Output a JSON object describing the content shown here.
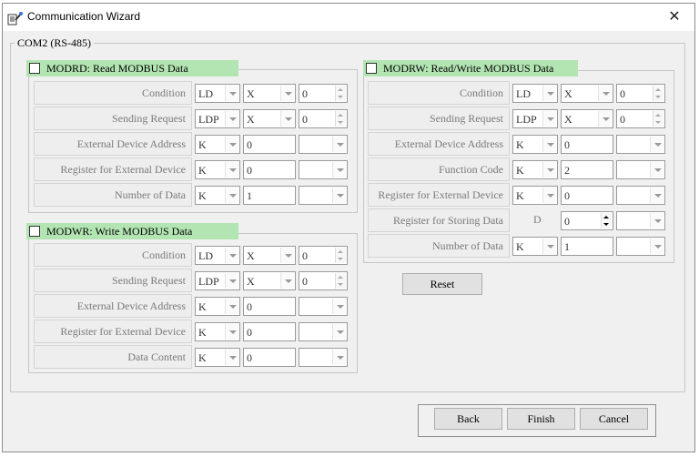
{
  "window": {
    "title": "Communication Wizard",
    "close_glyph": "✕",
    "icon": "wizard-app-icon"
  },
  "group": {
    "label": "COM2 (RS-485)"
  },
  "modrd": {
    "title": "MODRD: Read MODBUS Data",
    "checked": false,
    "rows": [
      {
        "label": "Condition",
        "type": "LD",
        "dev": "X",
        "num": "0"
      },
      {
        "label": "Sending Request",
        "type": "LDP",
        "dev": "X",
        "num": "0"
      },
      {
        "label": "External Device Address",
        "type": "K",
        "value": "0",
        "extra": ""
      },
      {
        "label": "Register for External Device",
        "type": "K",
        "value": "0",
        "extra": ""
      },
      {
        "label": "Number of Data",
        "type": "K",
        "value": "1",
        "extra": ""
      }
    ]
  },
  "modwr": {
    "title": "MODWR: Write MODBUS Data",
    "checked": false,
    "rows": [
      {
        "label": "Condition",
        "type": "LD",
        "dev": "X",
        "num": "0"
      },
      {
        "label": "Sending Request",
        "type": "LDP",
        "dev": "X",
        "num": "0"
      },
      {
        "label": "External Device Address",
        "type": "K",
        "value": "0",
        "extra": ""
      },
      {
        "label": "Register for External Device",
        "type": "K",
        "value": "0",
        "extra": ""
      },
      {
        "label": "Data Content",
        "type": "K",
        "value": "0",
        "extra": ""
      }
    ]
  },
  "modrw": {
    "title": "MODRW: Read/Write MODBUS Data",
    "checked": false,
    "rows": [
      {
        "label": "Condition",
        "type": "LD",
        "dev": "X",
        "num": "0"
      },
      {
        "label": "Sending Request",
        "type": "LDP",
        "dev": "X",
        "num": "0"
      },
      {
        "label": "External Device Address",
        "type": "K",
        "value": "0",
        "extra": ""
      },
      {
        "label": "Function Code",
        "type": "K",
        "value": "2",
        "extra": ""
      },
      {
        "label": "Register for External Device",
        "type": "K",
        "value": "0",
        "extra": ""
      },
      {
        "label": "Register for Storing Data",
        "static": "D",
        "num": "0",
        "extra": ""
      },
      {
        "label": "Number of Data",
        "type": "K",
        "value": "1",
        "extra": ""
      }
    ]
  },
  "buttons": {
    "reset": "Reset",
    "back": "Back",
    "finish": "Finish",
    "cancel": "Cancel"
  },
  "colors": {
    "section_header": "#b3e5b3",
    "window_bg": "#f0f0f0",
    "label_text": "#7a7a7a"
  }
}
